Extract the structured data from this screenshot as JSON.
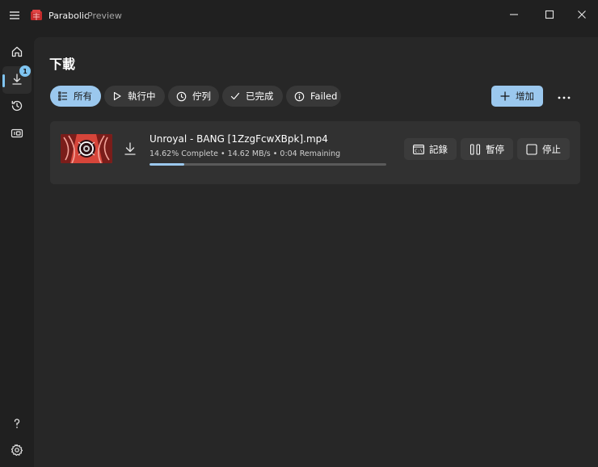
{
  "window": {
    "app_name": "Parabolic",
    "subtitle": "Preview",
    "icons": {
      "menu": "hamburger-icon",
      "logo": "parabolic-logo-icon",
      "minimize": "minimize-icon",
      "maximize": "maximize-icon",
      "close": "close-icon"
    }
  },
  "sidebar": {
    "items": [
      {
        "name": "home",
        "icon": "home-icon"
      },
      {
        "name": "downloads",
        "icon": "download-icon",
        "badge": "1",
        "active": true
      },
      {
        "name": "history",
        "icon": "history-icon"
      },
      {
        "name": "keyring",
        "icon": "keyring-icon"
      }
    ],
    "bottom_items": [
      {
        "name": "help",
        "icon": "help-icon"
      },
      {
        "name": "settings",
        "icon": "gear-icon"
      }
    ]
  },
  "page": {
    "title": "下載",
    "filters": [
      {
        "label": "所有",
        "icon": "list-icon",
        "selected": true
      },
      {
        "label": "執行中",
        "icon": "play-icon"
      },
      {
        "label": "佇列",
        "icon": "clock-icon"
      },
      {
        "label": "已完成",
        "icon": "check-icon"
      },
      {
        "label": "Failed",
        "icon": "info-icon"
      }
    ],
    "add_label": "增加",
    "more_icon": "more-icon"
  },
  "downloads": [
    {
      "file_name": "Unroyal - BANG [1ZzgFcwXBpk].mp4",
      "status_text": "14.62% Complete • 14.62 MB/s • 0:04 Remaining",
      "progress": 0.1462,
      "buttons": {
        "log": "記錄",
        "pause": "暫停",
        "stop": "停止"
      }
    }
  ],
  "colors": {
    "accent": "#9bc8ee",
    "background": "#202020",
    "content_bg": "#272727",
    "card_bg": "#313131"
  }
}
